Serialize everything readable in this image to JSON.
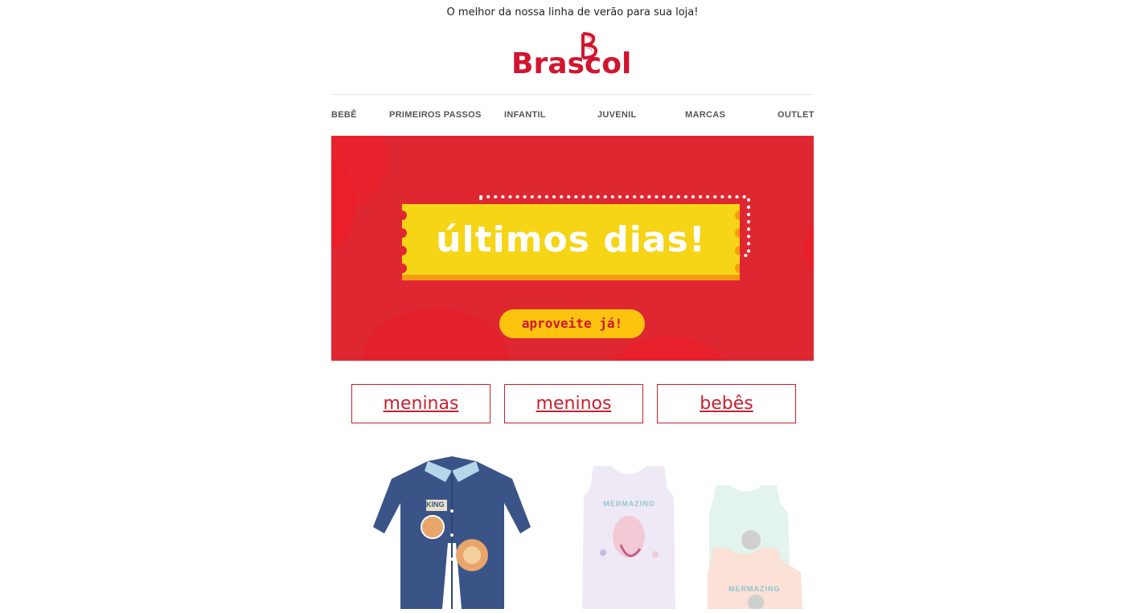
{
  "preheader": "O melhor da nossa linha de verão para sua loja!",
  "brand": {
    "name": "Brascol",
    "color": "#d2152e"
  },
  "nav": {
    "items": [
      {
        "label": "BEBÊ"
      },
      {
        "label": "PRIMEIROS PASSOS"
      },
      {
        "label": "INFANTIL"
      },
      {
        "label": "JUVENIL"
      },
      {
        "label": "MARCAS"
      },
      {
        "label": "OUTLET"
      }
    ]
  },
  "hero": {
    "headline": "últimos dias!",
    "cta_label": "aproveite já!",
    "background_color": "#df2732",
    "ticket_color": "#f6d416",
    "cta_color": "#fcc40f"
  },
  "categories": [
    {
      "label": "meninas"
    },
    {
      "label": "meninos"
    },
    {
      "label": "bebês"
    }
  ],
  "products": {
    "items": [
      {
        "name": "navy-romper",
        "print": "KING"
      },
      {
        "name": "lilac-tank-bodysuit",
        "print": "MERMAZING"
      },
      {
        "name": "mint-peach-tank-bodysuit-pair",
        "print": "MERMAZING"
      }
    ]
  }
}
